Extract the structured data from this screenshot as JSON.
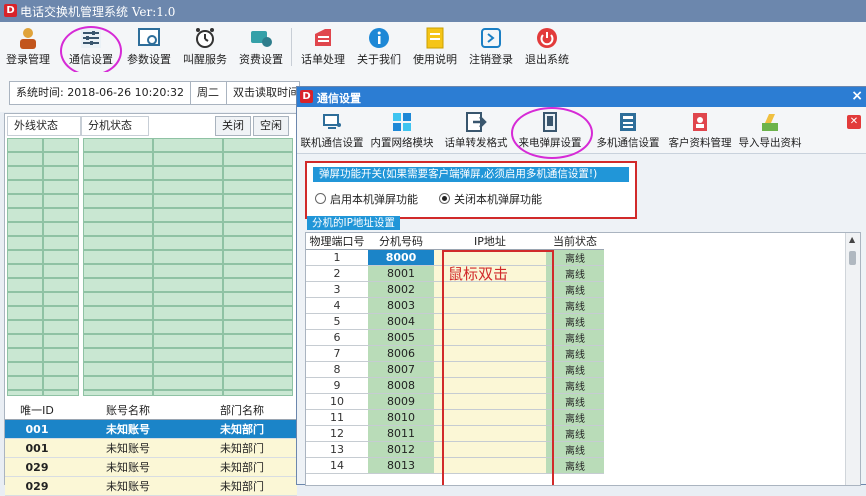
{
  "app": {
    "logo": "D",
    "title": "电话交换机管理系统  Ver:1.0"
  },
  "toolbar": {
    "buttons": [
      {
        "label": "登录管理",
        "icon": "user-icon"
      },
      {
        "label": "通信设置",
        "icon": "sliders-icon"
      },
      {
        "label": "参数设置",
        "icon": "settings-window-icon"
      },
      {
        "label": "叫醒服务",
        "icon": "alarm-clock-icon"
      },
      {
        "label": "资费设置",
        "icon": "money-icon"
      },
      {
        "label": "话单处理",
        "icon": "document-stack-icon"
      },
      {
        "label": "关于我们",
        "icon": "info-icon"
      },
      {
        "label": "使用说明",
        "icon": "manual-icon"
      },
      {
        "label": "注销登录",
        "icon": "logout-icon"
      },
      {
        "label": "退出系统",
        "icon": "power-icon"
      }
    ]
  },
  "status": {
    "time_label": "系统时间: 2018-06-26 10:20:32",
    "weekday": "周二",
    "hint": "双击读取时间"
  },
  "left": {
    "tabs": {
      "outside": "外线状态",
      "extension": "分机状态"
    },
    "buttons": {
      "close": "关闭",
      "idle": "空闲"
    },
    "table": {
      "headers": [
        "唯一ID",
        "账号名称",
        "部门名称"
      ],
      "rows": [
        [
          "001",
          "未知账号",
          "未知部门"
        ],
        [
          "001",
          "未知账号",
          "未知部门"
        ],
        [
          "029",
          "未知账号",
          "未知部门"
        ],
        [
          "029",
          "未知账号",
          "未知部门"
        ]
      ]
    }
  },
  "dialog": {
    "logo": "D",
    "title": "通信设置",
    "close": "×",
    "toolbar": [
      {
        "label": "联机通信设置",
        "icon": "pc-connect-icon"
      },
      {
        "label": "内置网络模块",
        "icon": "network-module-icon"
      },
      {
        "label": "话单转发格式",
        "icon": "forward-arrow-icon"
      },
      {
        "label": "来电弹屏设置",
        "icon": "phone-screen-icon"
      },
      {
        "label": "多机通信设置",
        "icon": "multi-machine-icon"
      },
      {
        "label": "客户资料管理",
        "icon": "client-file-icon"
      },
      {
        "label": "导入导出资料",
        "icon": "import-export-icon"
      }
    ],
    "close_icon": "✕",
    "popup": {
      "header": "弹屏功能开关(如果需要客户端弹屏,必须启用多机通信设置!)",
      "enable": "启用本机弹屏功能",
      "disable": "关闭本机弹屏功能",
      "selected": "disable"
    },
    "ip_section_label": "分机的IP地址设置",
    "ip_table": {
      "headers": [
        "物理端口号",
        "分机号码",
        "IP地址",
        "当前状态"
      ],
      "rows": [
        [
          "1",
          "8000",
          "",
          "离线"
        ],
        [
          "2",
          "8001",
          "",
          "离线"
        ],
        [
          "3",
          "8002",
          "",
          "离线"
        ],
        [
          "4",
          "8003",
          "",
          "离线"
        ],
        [
          "5",
          "8004",
          "",
          "离线"
        ],
        [
          "6",
          "8005",
          "",
          "离线"
        ],
        [
          "7",
          "8006",
          "",
          "离线"
        ],
        [
          "8",
          "8007",
          "",
          "离线"
        ],
        [
          "9",
          "8008",
          "",
          "离线"
        ],
        [
          "10",
          "8009",
          "",
          "离线"
        ],
        [
          "11",
          "8010",
          "",
          "离线"
        ],
        [
          "12",
          "8011",
          "",
          "离线"
        ],
        [
          "13",
          "8012",
          "",
          "离线"
        ],
        [
          "14",
          "8013",
          "",
          "离线"
        ]
      ]
    },
    "annotation": "鼠标双击"
  },
  "colors": {
    "titlebar": "#6c87ad",
    "dialog_title": "#2c7dd3",
    "selected": "#1b84c8",
    "highlight_red": "#d12a2a",
    "circle": "#d62ad6"
  }
}
